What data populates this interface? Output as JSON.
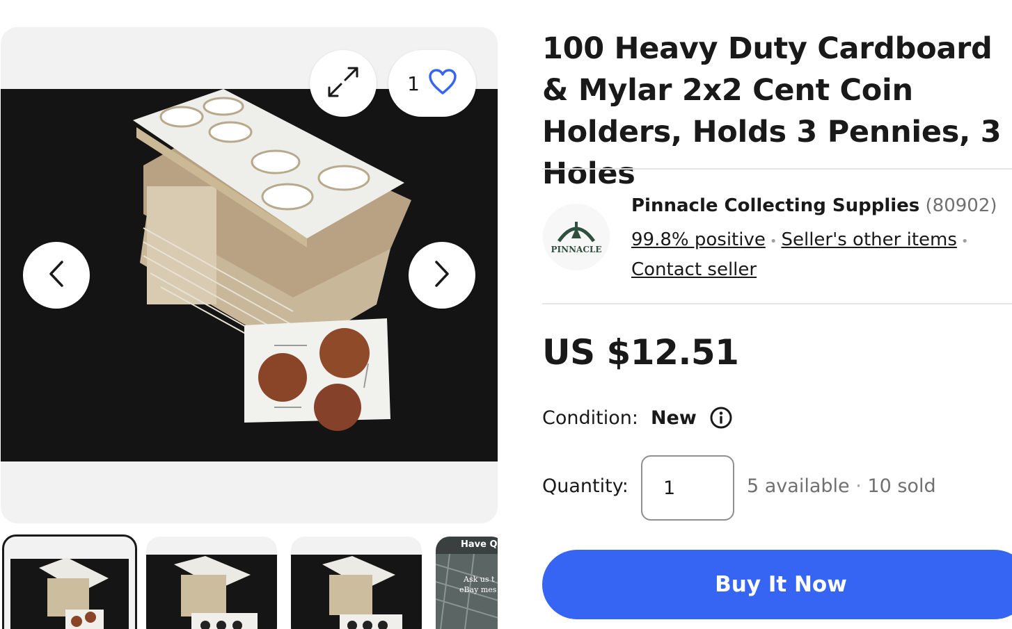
{
  "listing": {
    "title": "100 Heavy Duty Cardboard & Mylar 2x2 Cent Coin Holders, Holds 3 Pennies, 3 Holes",
    "watch_count": "1",
    "price": "US $12.51"
  },
  "seller": {
    "name": "Pinnacle Collecting Supplies",
    "feedback_count": "(80902)",
    "positive": "99.8% positive",
    "other_items": "Seller's other items",
    "contact": "Contact seller",
    "logo_text": "PINNACLE"
  },
  "condition": {
    "label": "Condition:",
    "value": "New"
  },
  "quantity": {
    "label": "Quantity:",
    "value": "1",
    "available": "5 available",
    "sold": "10 sold",
    "separator": "·"
  },
  "buy_button": {
    "label": "Buy It Now"
  },
  "thumbnails": {
    "fourth_text_1": "Have Q",
    "fourth_text_2": "Ask us t",
    "fourth_text_3": "eBay mes"
  },
  "icons": {
    "prev": "chevron-left-icon",
    "next": "chevron-right-icon",
    "expand": "expand-icon",
    "watch": "heart-icon",
    "info": "info-icon"
  },
  "colors": {
    "accent": "#3665f3",
    "heart": "#3665f3"
  }
}
